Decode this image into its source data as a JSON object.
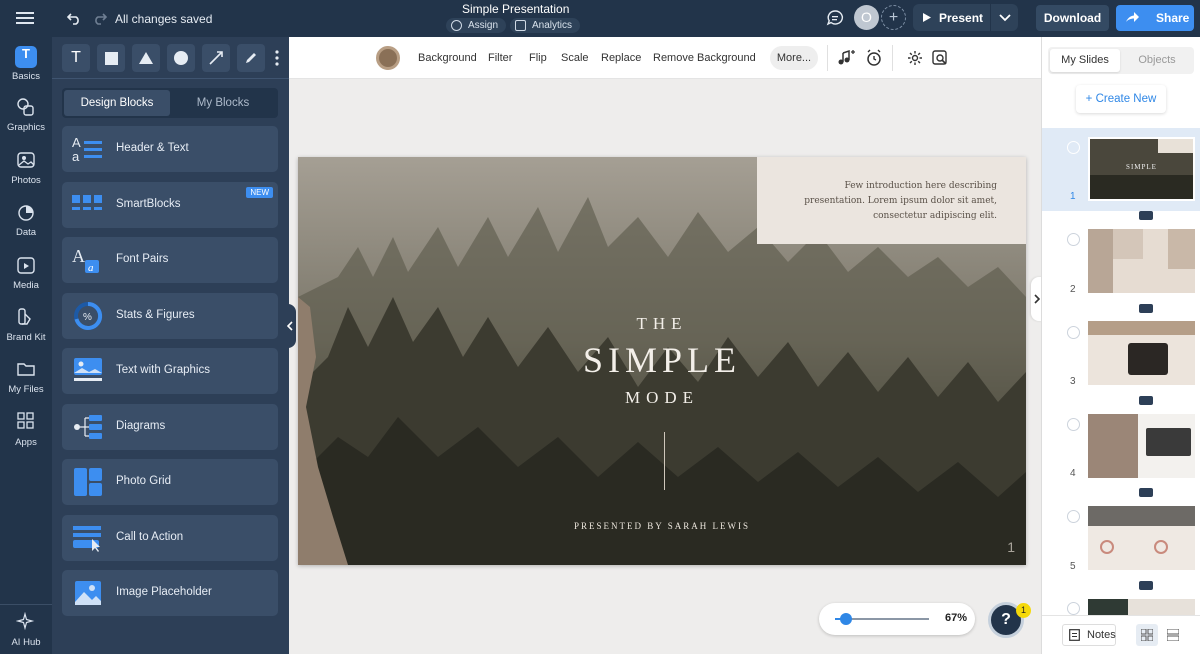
{
  "topbar": {
    "status": "All changes saved",
    "doc_title": "Simple Presentation",
    "assign_label": "Assign",
    "analytics_label": "Analytics",
    "avatar_initial": "O",
    "present_label": "Present",
    "download_label": "Download",
    "share_label": "Share"
  },
  "rail": {
    "items": [
      {
        "label": "Basics",
        "icon": "basics-icon"
      },
      {
        "label": "Graphics",
        "icon": "graphics-icon"
      },
      {
        "label": "Photos",
        "icon": "photos-icon"
      },
      {
        "label": "Data",
        "icon": "data-icon"
      },
      {
        "label": "Media",
        "icon": "media-icon"
      },
      {
        "label": "Brand Kit",
        "icon": "brand-kit-icon"
      },
      {
        "label": "My Files",
        "icon": "folder-icon"
      },
      {
        "label": "Apps",
        "icon": "apps-icon"
      }
    ],
    "ai_hub_label": "AI Hub"
  },
  "panel": {
    "tabs": [
      "Design Blocks",
      "My Blocks"
    ],
    "blocks": [
      {
        "label": "Header & Text"
      },
      {
        "label": "SmartBlocks",
        "badge": "NEW"
      },
      {
        "label": "Font Pairs"
      },
      {
        "label": "Stats & Figures"
      },
      {
        "label": "Text with Graphics"
      },
      {
        "label": "Diagrams"
      },
      {
        "label": "Photo Grid"
      },
      {
        "label": "Call to Action"
      },
      {
        "label": "Image Placeholder"
      }
    ]
  },
  "canvas_toolbar": {
    "items": [
      "Background",
      "Filter",
      "Flip",
      "Scale",
      "Replace",
      "Remove Background"
    ],
    "more_label": "More..."
  },
  "slide": {
    "intro": "Few introduction here describing presentation. Lorem ipsum dolor sit amet, consectetur adipiscing elit.",
    "title_the": "THE",
    "title_simple": "SIMPLE",
    "title_mode": "MODE",
    "presenter": "PRESENTED BY SARAH LEWIS",
    "page_number": "1"
  },
  "zoom": {
    "label": "67%",
    "level": 0.12
  },
  "help": {
    "label": "?",
    "badge": "1"
  },
  "right": {
    "tabs": [
      "My Slides",
      "Objects"
    ],
    "create_new": "+ Create New",
    "slide_numbers": [
      "1",
      "2",
      "3",
      "4",
      "5"
    ],
    "notes_label": "Notes"
  },
  "colors": {
    "dark": "#22344a",
    "panel": "#2d3f57",
    "accent": "#2f87e6",
    "brand": "#3d8ef0"
  }
}
